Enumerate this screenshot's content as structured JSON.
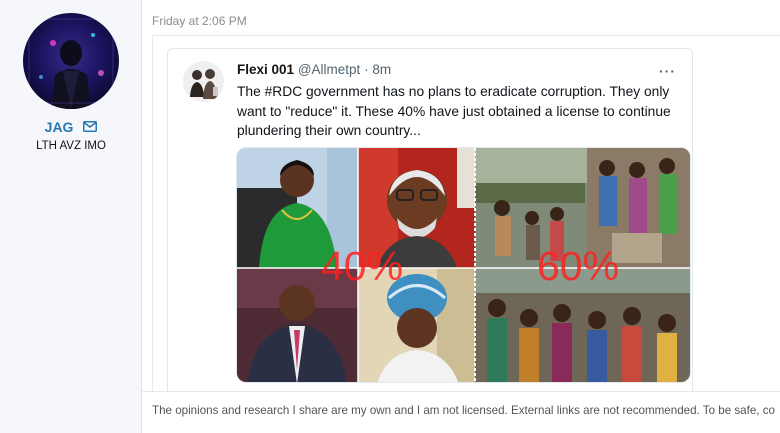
{
  "user": {
    "name": "JAG",
    "title": "LTH AVZ IMO"
  },
  "post": {
    "date": "Friday at 2:06 PM",
    "signature": "The opinions and research I share are my own and I am not licensed. External links are not recommended. To be safe, co"
  },
  "tweet": {
    "display_name": "Flexi 001",
    "handle": "@Allmetpt",
    "separator": "·",
    "time": "8m",
    "more": "···",
    "text": "The #RDC government  has no plans to eradicate corruption. They only want to \"reduce\" it. These 40% have just obtained a license to continue plundering their own country...",
    "image": {
      "left_label": "40%",
      "right_label": "60%"
    }
  }
}
